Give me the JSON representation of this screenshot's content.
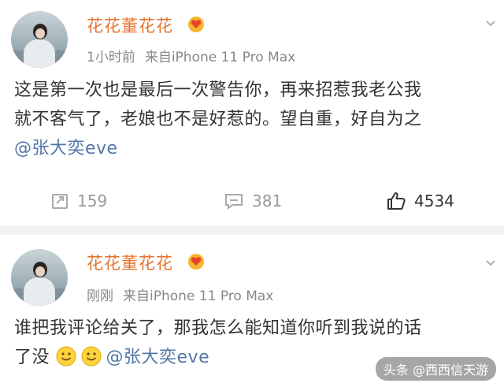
{
  "posts": [
    {
      "author": "花花董花花",
      "time": "1小时前",
      "source": "来自iPhone 11 Pro Max",
      "text_line1": "这是第一次也是最后一次警告你，再来招惹我老公我",
      "text_line2": "就不客气了，老娘也不是好惹的。望自重，好自为之",
      "mention": "@张大奕eve",
      "reposts": "159",
      "comments": "381",
      "likes": "4534"
    },
    {
      "author": "花花董花花",
      "time": "刚刚",
      "source": "来自iPhone 11 Pro Max",
      "text_line1": "谁把我评论给关了，那我怎么能知道你听到我说的话",
      "text_line2_prefix": "了没",
      "mention": "@张大奕eve"
    }
  ],
  "watermark": "头条 @西西信天游",
  "icons": {
    "badge": "vip-heart-badge-icon",
    "repost": "repost-icon",
    "comment": "comment-icon",
    "like": "thumbs-up-icon",
    "more": "chevron-down-icon",
    "emoji": "smile-emoji-icon"
  },
  "colors": {
    "author": "#e8722a",
    "mention": "#5177a8",
    "meta": "#888888"
  }
}
